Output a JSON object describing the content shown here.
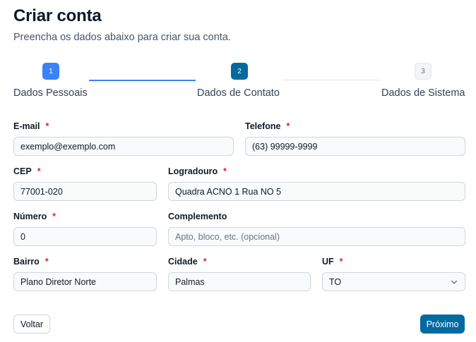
{
  "header": {
    "title": "Criar conta",
    "subtitle": "Preencha os dados abaixo para criar sua conta."
  },
  "stepper": {
    "steps": [
      {
        "number": "1",
        "label": "Dados Pessoais",
        "state": "completed"
      },
      {
        "number": "2",
        "label": "Dados de Contato",
        "state": "active"
      },
      {
        "number": "3",
        "label": "Dados de Sistema",
        "state": "pending"
      }
    ]
  },
  "form": {
    "required_mark": "*",
    "email": {
      "label": "E-mail",
      "value": "exemplo@exemplo.com"
    },
    "telefone": {
      "label": "Telefone",
      "value": "(63) 99999-9999"
    },
    "cep": {
      "label": "CEP",
      "value": "77001-020"
    },
    "logradouro": {
      "label": "Logradouro",
      "value": "Quadra ACNO 1 Rua NO 5"
    },
    "numero": {
      "label": "Número",
      "value": "0"
    },
    "complemento": {
      "label": "Complemento",
      "value": "",
      "placeholder": "Apto, bloco, etc. (opcional)"
    },
    "bairro": {
      "label": "Bairro",
      "value": "Plano Diretor Norte"
    },
    "cidade": {
      "label": "Cidade",
      "value": "Palmas"
    },
    "uf": {
      "label": "UF",
      "value": "TO"
    }
  },
  "actions": {
    "back_label": "Voltar",
    "next_label": "Próximo"
  },
  "colors": {
    "primary": "#0369a1",
    "step_completed": "#3b82f6",
    "required": "#dc2626"
  }
}
